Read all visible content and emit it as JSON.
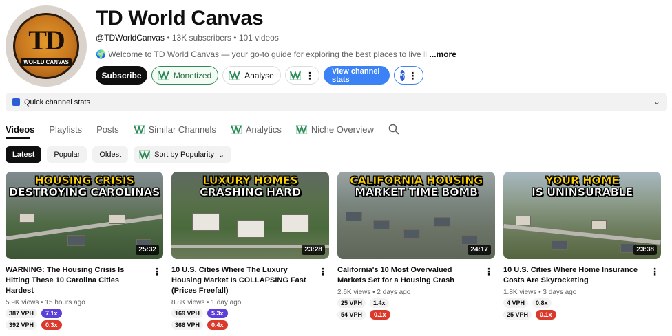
{
  "channel": {
    "name": "TD World Canvas",
    "avatar_text": "TD",
    "avatar_subtext": "WORLD CANVAS",
    "handle": "@TDWorldCanvas",
    "subscribers": "13K subscribers",
    "videos_count": "101 videos",
    "description": "🌍 Welcome to TD World Canvas — your go-to guide for exploring the best places to live",
    "description_more": "...more"
  },
  "buttons": {
    "subscribe": "Subscribe",
    "monetized": "Monetized",
    "analyse": "Analyse",
    "view_stats": "View channel stats",
    "iq": "IQ"
  },
  "quick_stats": {
    "label": "Quick channel stats"
  },
  "tabs": [
    {
      "label": "Videos"
    },
    {
      "label": "Playlists"
    },
    {
      "label": "Posts"
    },
    {
      "label": "Similar Channels"
    },
    {
      "label": "Analytics"
    },
    {
      "label": "Niche Overview"
    }
  ],
  "filters": {
    "latest": "Latest",
    "popular": "Popular",
    "oldest": "Oldest",
    "sort": "Sort by Popularity"
  },
  "videos": [
    {
      "caption_line1": "HOUSING CRISIS",
      "caption_line2": "DESTROYING CAROLINAS",
      "duration": "25:32",
      "title": "WARNING: The Housing Crisis Is Hitting These 10 Carolina Cities Hardest",
      "views": "5.9K views",
      "age": "15 hours ago",
      "vph1": "387 VPH",
      "mult1": "7.1x",
      "mult1_color": "#5b3fd6",
      "vph2": "392 VPH",
      "mult2": "0.3x",
      "mult2_color": "#d93a2b"
    },
    {
      "caption_line1": "LUXURY HOMES",
      "caption_line2": "CRASHING HARD",
      "duration": "23:28",
      "title": "10 U.S. Cities Where The Luxury Housing Market Is COLLAPSING Fast (Prices Freefall)",
      "views": "8.8K views",
      "age": "1 day ago",
      "vph1": "169 VPH",
      "mult1": "5.3x",
      "mult1_color": "#5b3fd6",
      "vph2": "366 VPH",
      "mult2": "0.4x",
      "mult2_color": "#d93a2b"
    },
    {
      "caption_line1": "CALIFORNIA HOUSING",
      "caption_line2": "MARKET TIME BOMB",
      "duration": "24:17",
      "title": "California's 10 Most Overvalued Markets Set for a Housing Crash",
      "views": "2.6K views",
      "age": "2 days ago",
      "vph1": "25 VPH",
      "mult1": "1.4x",
      "mult1_color": "",
      "vph2": "54 VPH",
      "mult2": "0.1x",
      "mult2_color": "#d93a2b"
    },
    {
      "caption_line1": "YOUR HOME",
      "caption_line2": "IS UNINSURABLE",
      "duration": "23:38",
      "title": "10 U.S. Cities Where Home Insurance Costs Are Skyrocketing",
      "views": "1.8K views",
      "age": "3 days ago",
      "vph1": "4 VPH",
      "mult1": "0.8x",
      "mult1_color": "",
      "vph2": "25 VPH",
      "mult2": "0.1x",
      "mult2_color": "#d93a2b"
    }
  ],
  "icons": {
    "vidiq": "vidiq-icon",
    "search": "search-icon",
    "chevron": "chevron-down-icon",
    "kebab": "more-vert-icon"
  },
  "colors": {
    "subscribe_bg": "#0f0f0f",
    "monetized_border": "#2e8b57",
    "view_stats_bg": "#3b82f6",
    "multiplier_high": "#5b3fd6",
    "multiplier_low": "#d93a2b"
  }
}
